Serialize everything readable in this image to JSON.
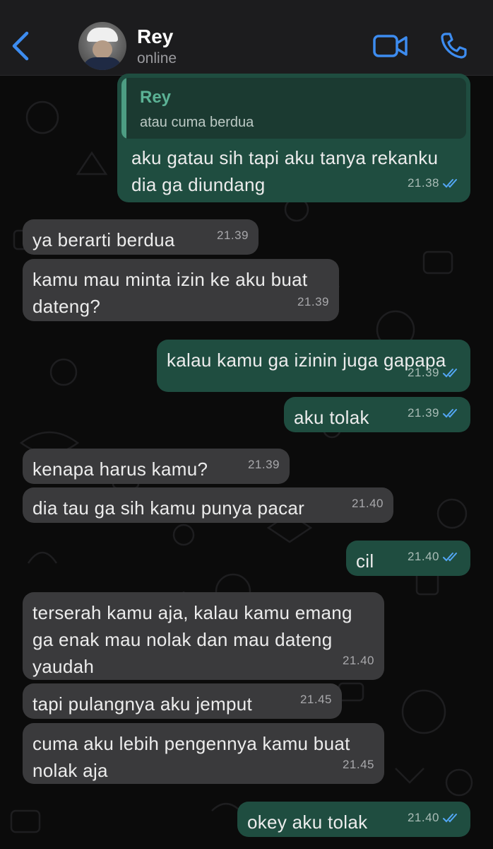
{
  "header": {
    "contact_name": "Rey",
    "status": "online"
  },
  "quote": {
    "author": "Rey",
    "text": "atau cuma berdua"
  },
  "messages": [
    {
      "dir": "out",
      "text": "aku gatau sih tapi aku tanya rekanku\ndia ga diundang",
      "time": "21.38"
    },
    {
      "dir": "in",
      "text": "ya berarti berdua",
      "time": "21.39"
    },
    {
      "dir": "in",
      "text": "kamu mau minta izin ke aku buat\ndateng?",
      "time": "21.39"
    },
    {
      "dir": "out",
      "text": "kalau kamu ga izinin juga gapapa",
      "time": "21.39"
    },
    {
      "dir": "out",
      "text": "aku tolak",
      "time": "21.39"
    },
    {
      "dir": "in",
      "text": "kenapa harus kamu?",
      "time": "21.39"
    },
    {
      "dir": "in",
      "text": "dia tau ga sih kamu punya pacar",
      "time": "21.40"
    },
    {
      "dir": "out",
      "text": "cil",
      "time": "21.40"
    },
    {
      "dir": "in",
      "text": "terserah kamu aja, kalau kamu emang\nga enak mau nolak dan mau dateng\nyaudah",
      "time": "21.40"
    },
    {
      "dir": "in",
      "text": "tapi pulangnya aku jemput",
      "time": "21.45"
    },
    {
      "dir": "in",
      "text": "cuma aku lebih pengennya kamu buat\nnolak aja",
      "time": "21.45"
    },
    {
      "dir": "out",
      "text": "okey aku tolak",
      "time": "21.40"
    }
  ],
  "colors": {
    "accent": "#3d8cf0",
    "incoming_bubble": "#3a3a3c",
    "outgoing_bubble": "#1f4d40",
    "read_tick": "#53a7f5"
  }
}
